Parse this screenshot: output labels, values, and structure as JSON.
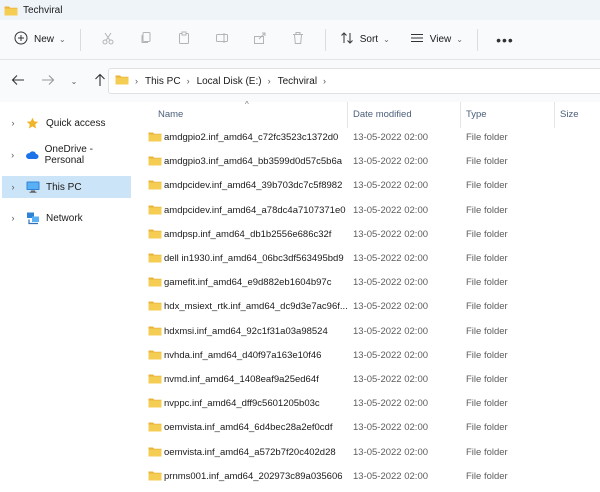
{
  "window": {
    "title": "Techviral"
  },
  "commands": {
    "new_label": "New",
    "sort_label": "Sort",
    "view_label": "View"
  },
  "address": {
    "crumbs": [
      "This PC",
      "Local Disk (E:)",
      "Techviral"
    ]
  },
  "nav_pane": {
    "items": [
      {
        "label": "Quick access",
        "icon": "star-icon"
      },
      {
        "label": "OneDrive - Personal",
        "icon": "cloud-icon"
      },
      {
        "label": "This PC",
        "icon": "computer-icon",
        "selected": true
      },
      {
        "label": "Network",
        "icon": "network-icon"
      }
    ]
  },
  "columns": {
    "name": "Name",
    "date": "Date modified",
    "type": "Type",
    "size": "Size"
  },
  "files": [
    {
      "name": "amdgpio2.inf_amd64_c72fc3523c1372d0",
      "date": "13-05-2022 02:00",
      "type": "File folder"
    },
    {
      "name": "amdgpio3.inf_amd64_bb3599d0d57c5b6a",
      "date": "13-05-2022 02:00",
      "type": "File folder"
    },
    {
      "name": "amdpcidev.inf_amd64_39b703dc7c5f8982",
      "date": "13-05-2022 02:00",
      "type": "File folder"
    },
    {
      "name": "amdpcidev.inf_amd64_a78dc4a7107371e0",
      "date": "13-05-2022 02:00",
      "type": "File folder"
    },
    {
      "name": "amdpsp.inf_amd64_db1b2556e686c32f",
      "date": "13-05-2022 02:00",
      "type": "File folder"
    },
    {
      "name": "dell in1930.inf_amd64_06bc3df563495bd9",
      "date": "13-05-2022 02:00",
      "type": "File folder"
    },
    {
      "name": "gamefit.inf_amd64_e9d882eb1604b97c",
      "date": "13-05-2022 02:00",
      "type": "File folder"
    },
    {
      "name": "hdx_msiext_rtk.inf_amd64_dc9d3e7ac96f...",
      "date": "13-05-2022 02:00",
      "type": "File folder"
    },
    {
      "name": "hdxmsi.inf_amd64_92c1f31a03a98524",
      "date": "13-05-2022 02:00",
      "type": "File folder"
    },
    {
      "name": "nvhda.inf_amd64_d40f97a163e10f46",
      "date": "13-05-2022 02:00",
      "type": "File folder"
    },
    {
      "name": "nvmd.inf_amd64_1408eaf9a25ed64f",
      "date": "13-05-2022 02:00",
      "type": "File folder"
    },
    {
      "name": "nvppc.inf_amd64_dff9c5601205b03c",
      "date": "13-05-2022 02:00",
      "type": "File folder"
    },
    {
      "name": "oemvista.inf_amd64_6d4bec28a2ef0cdf",
      "date": "13-05-2022 02:00",
      "type": "File folder"
    },
    {
      "name": "oemvista.inf_amd64_a572b7f20c402d28",
      "date": "13-05-2022 02:00",
      "type": "File folder"
    },
    {
      "name": "prnms001.inf_amd64_202973c89a035606",
      "date": "13-05-2022 02:00",
      "type": "File folder"
    }
  ],
  "colors": {
    "folder": "#f3c54a",
    "selection": "#cce4f7",
    "accent": "#1a73e8"
  }
}
